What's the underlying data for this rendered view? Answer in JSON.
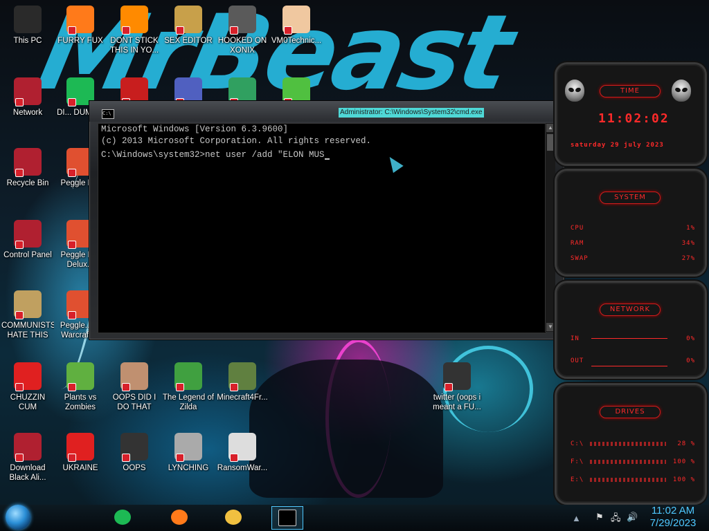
{
  "desktop": {
    "icons": [
      {
        "label": "This PC",
        "icon": "computer-icon",
        "color": "#2a2a2a"
      },
      {
        "label": "FURRY FUX",
        "icon": "firefox-icon",
        "color": "#ff7a1a"
      },
      {
        "label": "DONT STICK THIS IN YO...",
        "icon": "vlc-cone-icon",
        "color": "#ff8a00"
      },
      {
        "label": "SEX EDITOR",
        "icon": "hex-editor-icon",
        "color": "#c8a04a"
      },
      {
        "label": "HOOKED ON XONIX",
        "icon": "xonix-game-icon",
        "color": "#5a5a5a"
      },
      {
        "label": "VM0Technic...",
        "icon": "doctor-icon",
        "color": "#f0c8a0"
      },
      {
        "label": "Network",
        "icon": "network-icon",
        "color": "#b02030"
      },
      {
        "label": "DI... DUME...",
        "icon": "spotify-icon",
        "color": "#1db954"
      },
      {
        "label": "",
        "icon": "dev-cpp-icon",
        "color": "#c81e1e"
      },
      {
        "label": "",
        "icon": "app-window-icon",
        "color": "#5060c0"
      },
      {
        "label": "",
        "icon": "santa-icon",
        "color": "#30a060"
      },
      {
        "label": "",
        "icon": "lime-icon",
        "color": "#50c040"
      },
      {
        "label": "Recycle Bin",
        "icon": "recycle-bin-icon",
        "color": "#b02030"
      },
      {
        "label": "Peggle D...",
        "icon": "peggle-icon",
        "color": "#e05030"
      },
      {
        "label": "Control Panel",
        "icon": "control-panel-icon",
        "color": "#b02030"
      },
      {
        "label": "Peggle N... Delux...",
        "icon": "peggle-icon",
        "color": "#e05030"
      },
      {
        "label": "COMMUNISTS HATE THIS G...",
        "icon": "money-bag-icon",
        "color": "#c0a060"
      },
      {
        "label": "Peggle... of Warcraft ...",
        "icon": "peggle-icon",
        "color": "#e05030"
      },
      {
        "label": "CHUZZIN CUM",
        "icon": "chuzzle-icon",
        "color": "#e02020"
      },
      {
        "label": "Plants vs Zombies",
        "icon": "plants-vs-zombies-icon",
        "color": "#60b040"
      },
      {
        "label": "OOPS DID I DO THAT",
        "icon": "portrait-icon",
        "color": "#c09070"
      },
      {
        "label": "The Legend of Zilda",
        "icon": "zelda-icon",
        "color": "#40a040"
      },
      {
        "label": "Minecraft4Fr...",
        "icon": "minecraft-icon",
        "color": "#608040"
      },
      {
        "label": "twitter (oops i meant a FU...",
        "icon": "monitor-icon",
        "color": "#333"
      },
      {
        "label": "Download Black Ali...",
        "icon": "alienware-icon",
        "color": "#b02030"
      },
      {
        "label": "UKRAINE",
        "icon": "radiation-icon",
        "color": "#e02020"
      },
      {
        "label": "OOPS",
        "icon": "monitor-icon",
        "color": "#333"
      },
      {
        "label": "LYNCHING",
        "icon": "gear-icon",
        "color": "#aaa"
      },
      {
        "label": "RansomWar...",
        "icon": "skull-icon",
        "color": "#ddd"
      }
    ]
  },
  "wallpaper": {
    "brush_text_a": "MrBeast",
    "brush_color": "#27b6dc"
  },
  "cmd": {
    "title": "Administrator: C:\\Windows\\System32\\cmd.exe",
    "icon_text": "C:\\",
    "lines": [
      "Microsoft Windows [Version 6.3.9600]",
      "(c) 2013 Microsoft Corporation. All rights reserved.",
      "",
      "C:\\Windows\\system32>net user /add \"ELON MUS"
    ]
  },
  "gadgets": {
    "time": {
      "header": "TIME",
      "clock": "11:02:02",
      "date": "saturday 29 july 2023"
    },
    "system": {
      "header": "SYSTEM",
      "rows": [
        {
          "label": "CPU",
          "value": "1%"
        },
        {
          "label": "RAM",
          "value": "34%"
        },
        {
          "label": "SWAP",
          "value": "27%"
        }
      ]
    },
    "network": {
      "header": "NETWORK",
      "rows": [
        {
          "label": "IN",
          "value": "0%"
        },
        {
          "label": "OUT",
          "value": "0%"
        }
      ]
    },
    "drives": {
      "header": "DRIVES",
      "rows": [
        {
          "label": "C:\\",
          "value": "28 %"
        },
        {
          "label": "F:\\",
          "value": "100 %"
        },
        {
          "label": "E:\\",
          "value": "100 %"
        }
      ]
    }
  },
  "taskbar": {
    "buttons": [
      {
        "name": "spotify-taskbar-button",
        "icon": "spotify-icon",
        "color": "#1db954"
      },
      {
        "name": "firefox-taskbar-button",
        "icon": "firefox-icon",
        "color": "#ff7a1a"
      },
      {
        "name": "file-explorer-taskbar-button",
        "icon": "folder-icon",
        "color": "#f0c040"
      },
      {
        "name": "cmd-taskbar-button",
        "icon": "cmd-icon",
        "color": "#000000"
      }
    ],
    "clock_time": "11:02 AM",
    "clock_date": "7/29/2023"
  },
  "colors": {
    "accent_red": "#ff2a2a",
    "accent_blue": "#4fc8ff",
    "console_text": "#c8c8c8"
  }
}
